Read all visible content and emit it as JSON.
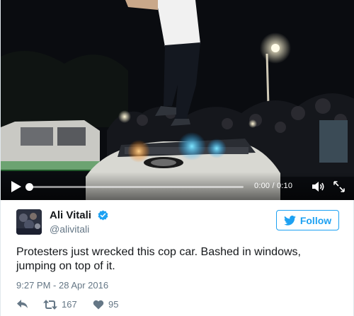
{
  "video": {
    "time_display": "0:00 / 0:10",
    "progress_fraction": 0.0
  },
  "tweet": {
    "author_name": "Ali Vitali",
    "author_handle": "@alivitali",
    "follow_label": "Follow",
    "text_line1": "Protesters just wrecked this cop car. Bashed in windows,",
    "text_line2": "jumping on top of it.",
    "timestamp": "9:27 PM - 28 Apr 2016",
    "retweet_count": "167",
    "like_count": "95"
  },
  "colors": {
    "accent": "#1da1f2",
    "secondary_text": "#657786",
    "verified": "#1da1f2"
  },
  "icons": [
    "play-icon",
    "volume-icon",
    "fullscreen-icon",
    "verified-icon",
    "twitter-bird-icon",
    "reply-icon",
    "retweet-icon",
    "like-icon"
  ]
}
